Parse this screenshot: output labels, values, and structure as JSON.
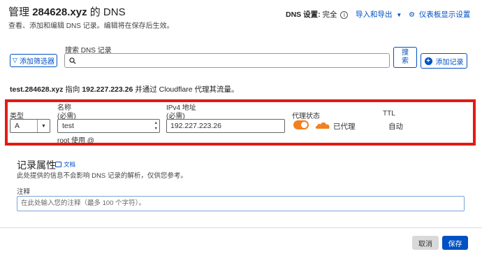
{
  "header": {
    "title_prefix": "管理",
    "domain": "284628.xyz",
    "title_suffix": "的 DNS",
    "subtitle": "查看、添加和编辑 DNS 记录。编辑将在保存后生效。",
    "dns_settings_label": "DNS 设置:",
    "dns_settings_value": "完全",
    "import_export": "导入和导出",
    "dashboard_settings": "仪表板显示设置"
  },
  "search": {
    "label": "搜索 DNS 记录",
    "filter_button": "添加筛选器",
    "search_button_line1": "搜",
    "search_button_line2": "索",
    "add_record_button": "添加记录"
  },
  "preview": {
    "hostname": "test.284628.xyz",
    "points_to": "指向",
    "ip": "192.227.223.26",
    "rest": "并通过 Cloudflare 代理其流量。"
  },
  "record_form": {
    "type_label": "类型",
    "type_value": "A",
    "name_label": "名称",
    "name_required": "(必需)",
    "name_value": "test",
    "name_hint": "root 使用 @",
    "ip_label": "IPv4 地址",
    "ip_required": "(必需)",
    "ip_value": "192.227.223.26",
    "proxy_label": "代理状态",
    "proxy_value": "已代理",
    "proxy_enabled": true,
    "ttl_label": "TTL",
    "ttl_value": "自动"
  },
  "attributes": {
    "title": "记录属性",
    "docs_link": "文档",
    "description": "此处提供的信息不会影响 DNS 记录的解析，仅供您参考。",
    "comment_label": "注释",
    "comment_placeholder": "在此处输入您的注释（最多 100 个字符）。"
  },
  "footer": {
    "cancel": "取消",
    "save": "保存"
  },
  "colors": {
    "accent": "#0051c3",
    "highlight_box": "#e11b14",
    "proxy_orange": "#f38020"
  }
}
